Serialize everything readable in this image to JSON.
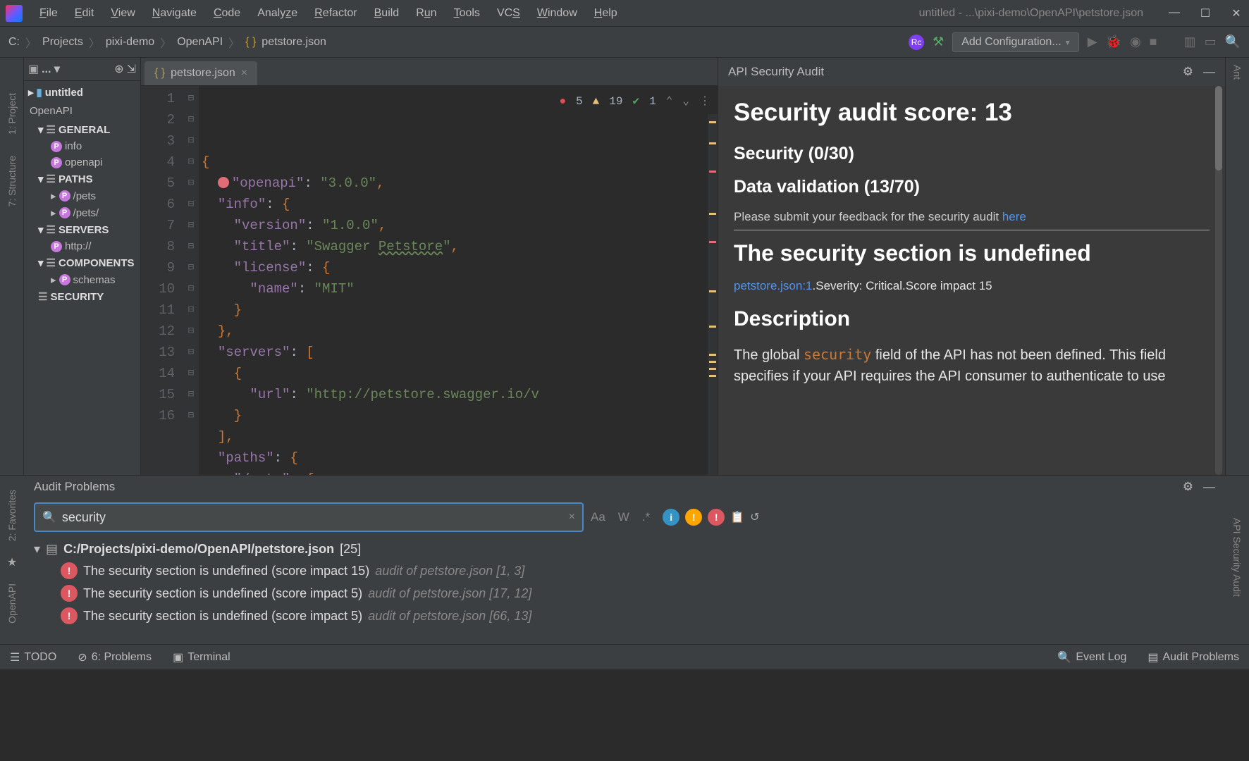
{
  "titlebar": {
    "menus": [
      "File",
      "Edit",
      "View",
      "Navigate",
      "Code",
      "Analyze",
      "Refactor",
      "Build",
      "Run",
      "Tools",
      "VCS",
      "Window",
      "Help"
    ],
    "title": "untitled - ...\\pixi-demo\\OpenAPI\\petstore.json"
  },
  "breadcrumb": [
    "C:",
    "Projects",
    "pixi-demo",
    "OpenAPI",
    "petstore.json"
  ],
  "config_button": "Add Configuration...",
  "left_tabs": [
    "1: Project",
    "7: Structure"
  ],
  "left_tabs_bottom": [
    "2: Favorites",
    "OpenAPI"
  ],
  "project": {
    "root": "untitled",
    "openapi_header": "OpenAPI",
    "sections": [
      {
        "name": "GENERAL",
        "items": [
          "info",
          "openapi"
        ]
      },
      {
        "name": "PATHS",
        "items": [
          "/pets",
          "/pets/"
        ]
      },
      {
        "name": "SERVERS",
        "items": [
          "http://"
        ]
      },
      {
        "name": "COMPONENTS",
        "items": [
          "schemas"
        ]
      },
      {
        "name": "SECURITY",
        "items": []
      }
    ]
  },
  "editor": {
    "tab": "petstore.json",
    "status": {
      "errors": "5",
      "warnings": "19",
      "ok": "1"
    },
    "lines": [
      {
        "n": "1",
        "html": "<span class='tok-punc'>{</span>"
      },
      {
        "n": "2",
        "html": "  <span class='bulb-icon'></span><span class='tok-key'>\"openapi\"</span>: <span class='tok-str'>\"3.0.0\"</span><span class='tok-punc'>,</span>"
      },
      {
        "n": "3",
        "html": "  <span class='tok-key'>\"info\"</span>: <span class='tok-punc'>{</span>"
      },
      {
        "n": "4",
        "html": "    <span class='tok-key'>\"version\"</span>: <span class='tok-str'>\"1.0.0\"</span><span class='tok-punc'>,</span>"
      },
      {
        "n": "5",
        "html": "    <span class='tok-key'>\"title\"</span>: <span class='tok-str'>\"Swagger <span class='tok-link'>Petstore</span>\"</span><span class='tok-punc'>,</span>"
      },
      {
        "n": "6",
        "html": "    <span class='tok-key'>\"license\"</span>: <span class='tok-punc'>{</span>"
      },
      {
        "n": "7",
        "html": "      <span class='tok-key'>\"name\"</span>: <span class='tok-str'>\"MIT\"</span>"
      },
      {
        "n": "8",
        "html": "    <span class='tok-punc'>}</span>"
      },
      {
        "n": "9",
        "html": "  <span class='tok-punc'>},</span>"
      },
      {
        "n": "10",
        "html": "  <span class='tok-key'>\"servers\"</span>: <span class='tok-punc'>[</span>"
      },
      {
        "n": "11",
        "html": "    <span class='tok-punc'>{</span>"
      },
      {
        "n": "12",
        "html": "      <span class='tok-key'>\"url\"</span>: <span class='tok-url'>\"http://petstore.swagger.io/v</span>"
      },
      {
        "n": "13",
        "html": "    <span class='tok-punc'>}</span>"
      },
      {
        "n": "14",
        "html": "  <span class='tok-punc'>],</span>"
      },
      {
        "n": "15",
        "html": "  <span class='tok-key'>\"paths\"</span>: <span class='tok-punc'>{</span>"
      },
      {
        "n": "16",
        "html": "    <span class='tok-key'>\"/pets\"</span>: <span class='tok-punc'>{</span>"
      }
    ]
  },
  "audit_panel": {
    "title": "API Security Audit",
    "score_heading": "Security audit score: 13",
    "security_line": "Security (0/30)",
    "data_validation_line": "Data validation (13/70)",
    "feedback_text": "Please submit your feedback for the security audit ",
    "feedback_link": "here",
    "issue_heading": "The security section is undefined",
    "meta_file": "petstore.json:1",
    "meta_rest": ".Severity: Critical.Score impact 15",
    "desc_heading": "Description",
    "desc_body_1": "The global ",
    "desc_hl": "security",
    "desc_body_2": " field of the API has not been defined. This field specifies if your API requires the API consumer to authenticate to use"
  },
  "right_tabs": [
    "Ant",
    "API Security Audit"
  ],
  "problems": {
    "title": "Audit Problems",
    "search_value": "security",
    "file": "C:/Projects/pixi-demo/OpenAPI/petstore.json",
    "file_count": "[25]",
    "issues": [
      {
        "msg": "The security section is undefined (score impact 15)",
        "src": "audit of petstore.json [1, 3]"
      },
      {
        "msg": "The security section is undefined (score impact 5)",
        "src": "audit of petstore.json [17, 12]"
      },
      {
        "msg": "The security section is undefined (score impact 5)",
        "src": "audit of petstore.json [66, 13]"
      }
    ]
  },
  "statusbar": {
    "left": [
      "TODO",
      "6: Problems",
      "Terminal"
    ],
    "right": [
      "Event Log",
      "Audit Problems"
    ]
  }
}
